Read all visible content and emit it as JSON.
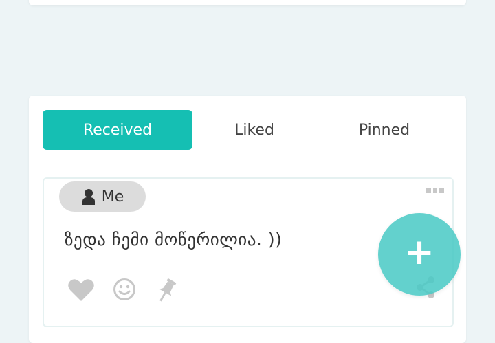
{
  "tabs": [
    {
      "label": "Received",
      "active": true
    },
    {
      "label": "Liked",
      "active": false
    },
    {
      "label": "Pinned",
      "active": false
    }
  ],
  "message": {
    "sender": "Me",
    "sender_icon": "person-icon",
    "text": "ზედა ჩემი მოწერილია. ))",
    "actions": [
      "heart-icon",
      "smiley-icon",
      "pin-icon",
      "share-icon"
    ],
    "menu_icon": "more-icon"
  },
  "fab": {
    "label": "+",
    "icon": "plus-icon"
  },
  "colors": {
    "accent": "#15bfb3",
    "fab": "#48c9c4",
    "background": "#edf4f6",
    "icon_gray": "#c8c8c8",
    "chip": "#dcdcdc"
  }
}
